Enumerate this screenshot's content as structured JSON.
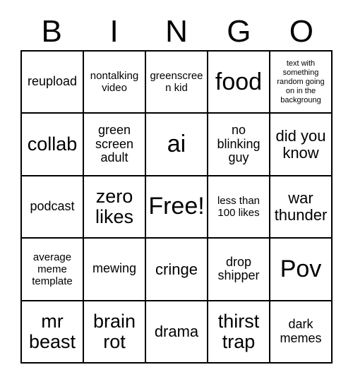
{
  "card": {
    "title": "BINGO",
    "header_letters": [
      "B",
      "I",
      "N",
      "G",
      "O"
    ],
    "grid_size": "5x5",
    "free_space_label": "Free!",
    "colors": {
      "background": "#ffffff",
      "grid_line": "#000000",
      "text": "#000000"
    },
    "rows": [
      [
        {
          "text": "reupload",
          "size": "fs-md"
        },
        {
          "text": "nontalking video",
          "size": "fs-sm"
        },
        {
          "text": "greenscreen kid",
          "size": "fs-sm"
        },
        {
          "text": "food",
          "size": "fs-xxl"
        },
        {
          "text": "text with something random going on in the backgroung",
          "size": "fs-xs"
        }
      ],
      [
        {
          "text": "collab",
          "size": "fs-xl"
        },
        {
          "text": "green screen adult",
          "size": "fs-md"
        },
        {
          "text": "ai",
          "size": "fs-xxl"
        },
        {
          "text": "no blinking guy",
          "size": "fs-md"
        },
        {
          "text": "did you know",
          "size": "fs-lg"
        }
      ],
      [
        {
          "text": "podcast",
          "size": "fs-md"
        },
        {
          "text": "zero likes",
          "size": "fs-xl"
        },
        {
          "text": "Free!",
          "size": "fs-xxl"
        },
        {
          "text": "less than 100 likes",
          "size": "fs-sm"
        },
        {
          "text": "war thunder",
          "size": "fs-lg"
        }
      ],
      [
        {
          "text": "average meme template",
          "size": "fs-sm"
        },
        {
          "text": "mewing",
          "size": "fs-md"
        },
        {
          "text": "cringe",
          "size": "fs-lg"
        },
        {
          "text": "drop shipper",
          "size": "fs-md"
        },
        {
          "text": "Pov",
          "size": "fs-xxl"
        }
      ],
      [
        {
          "text": "mr beast",
          "size": "fs-xl"
        },
        {
          "text": "brain rot",
          "size": "fs-xl"
        },
        {
          "text": "drama",
          "size": "fs-lg"
        },
        {
          "text": "thirst trap",
          "size": "fs-xl"
        },
        {
          "text": "dark memes",
          "size": "fs-md"
        }
      ]
    ]
  }
}
